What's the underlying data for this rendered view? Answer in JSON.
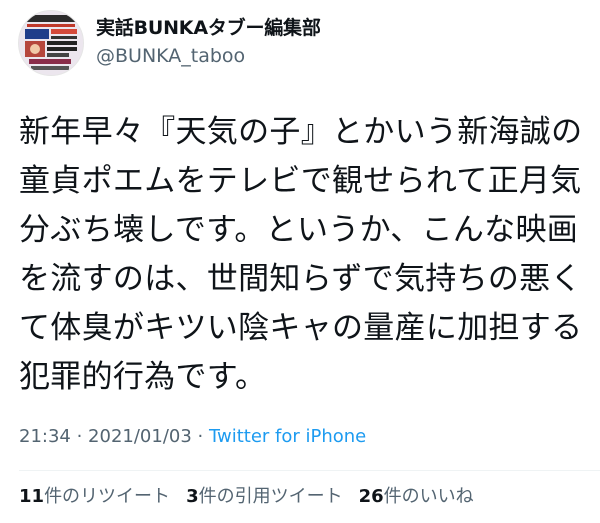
{
  "user": {
    "display_name": "実話BUNKAタブー編集部",
    "handle": "@BUNKA_taboo",
    "avatar": "magazine-cover-avatar"
  },
  "tweet": {
    "lines": [
      "新年早々『天気の子』とかいう新海誠の",
      "童貞ポエムをテレビで観せられて正月気",
      "分ぶち壊しです。というか、こんな映画",
      "を流すのは、世間知らずで気持ちの悪く",
      "て体臭がキツい陰キャの量産に加担する",
      "犯罪的行為です。"
    ]
  },
  "meta": {
    "time": "21:34",
    "separator1": " · ",
    "date": "2021/01/03",
    "separator2": " · ",
    "source": "Twitter for iPhone"
  },
  "stats": {
    "retweets_count": "11",
    "retweets_label": "件のリツイート",
    "quotes_count": "3",
    "quotes_label": "件の引用ツイート",
    "likes_count": "26",
    "likes_label": "件のいいね"
  },
  "colors": {
    "text": "#0f1419",
    "secondary": "#536471",
    "link": "#1d9bf0",
    "divider": "#eff3f4"
  }
}
